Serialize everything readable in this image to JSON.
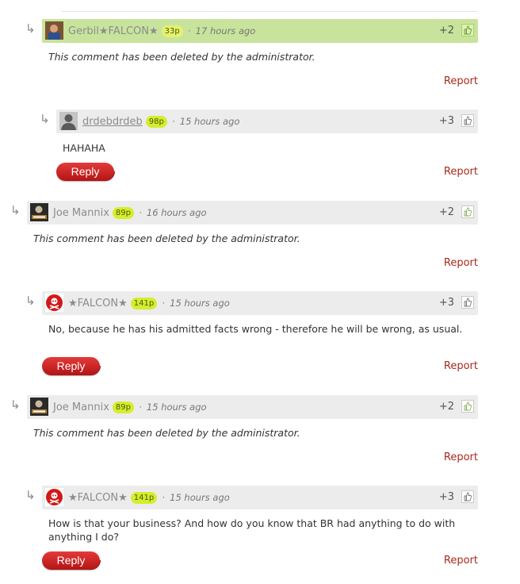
{
  "comments": [
    {
      "username": "Gerbil★FALCON★",
      "points": "33p",
      "time": "17 hours ago",
      "score": "+2",
      "body": "This comment has been deleted by the administrator.",
      "report": "Report"
    },
    {
      "username": "drdebdrdeb",
      "points": "98p",
      "time": "15 hours ago",
      "score": "+3",
      "body": "HAHAHA",
      "report": "Report",
      "reply": "Reply"
    },
    {
      "username": "Joe Mannix",
      "points": "89p",
      "time": "16 hours ago",
      "score": "+2",
      "body": "This comment has been deleted by the administrator.",
      "report": "Report"
    },
    {
      "username": "★FALCON★",
      "points": "141p",
      "time": "15 hours ago",
      "score": "+3",
      "body": "No, because he has his admitted facts wrong - therefore he will be wrong, as usual.",
      "report": "Report",
      "reply": "Reply"
    },
    {
      "username": "Joe Mannix",
      "points": "89p",
      "time": "15 hours ago",
      "score": "+2",
      "body": "This comment has been deleted by the administrator.",
      "report": "Report"
    },
    {
      "username": "★FALCON★",
      "points": "141p",
      "time": "15 hours ago",
      "score": "+3",
      "body": "How is that your business? And how do you know that BR had anything to do with anything I do?",
      "report": "Report",
      "reply": "Reply"
    }
  ],
  "separator": "·",
  "icons": {
    "reply_arrow": "reply-arrow-icon",
    "like": "thumbs-up-icon"
  },
  "colors": {
    "highlight": "#c8e49c",
    "header": "#ececec",
    "points_badge": "#d6ec2f",
    "report": "#a8291c",
    "reply_button": "#cc2626"
  }
}
